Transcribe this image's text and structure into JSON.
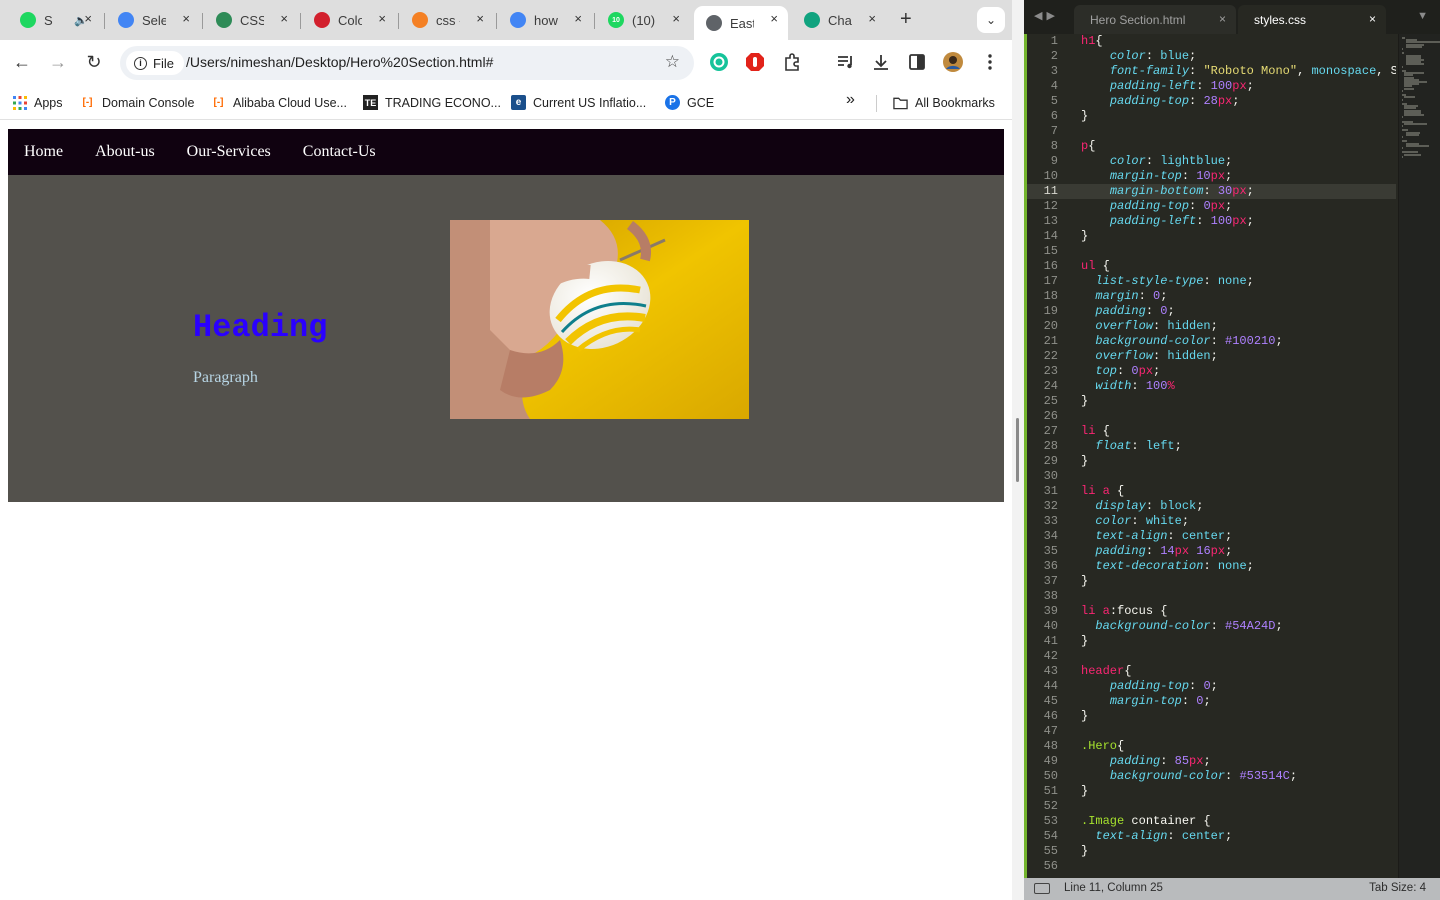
{
  "browser": {
    "tabs": [
      {
        "title": "S",
        "favicon_color": "#1ed760",
        "favicon": "spotify-icon"
      },
      {
        "title": "Selec",
        "favicon_color": "#4285f4",
        "favicon": "puzzle-icon"
      },
      {
        "title": "CSS",
        "favicon_color": "#2e8b57",
        "favicon": "w-icon"
      },
      {
        "title": "Colo",
        "favicon_color": "#d2202d",
        "favicon": "record-icon"
      },
      {
        "title": "css -",
        "favicon_color": "#f48024",
        "favicon": "stackoverflow-icon"
      },
      {
        "title": "how",
        "favicon_color": "#4285f4",
        "favicon": "google-icon"
      },
      {
        "title": "(10) ",
        "favicon_color": "#1ed760",
        "favicon": "badge-icon",
        "badge": "10"
      },
      {
        "title": "Easte",
        "favicon_color": "#5f6368",
        "favicon": "globe-icon"
      },
      {
        "title": "Chat",
        "favicon_color": "#10a37f",
        "favicon": "chatgpt-icon"
      }
    ],
    "tab_close": "×",
    "new_tab": "+",
    "tab_search": "⌄",
    "toolbar": {
      "back": "←",
      "forward": "→",
      "reload": "↻",
      "file_chip": "File",
      "url": "/Users/nimeshan/Desktop/Hero%20Section.html#",
      "star": "☆"
    },
    "bookmarks": [
      {
        "label": "Apps"
      },
      {
        "label": "Domain Console"
      },
      {
        "label": "Alibaba Cloud Use..."
      },
      {
        "label": "TRADING ECONO..."
      },
      {
        "label": "Current US Inflatio..."
      },
      {
        "label": "GCE"
      }
    ],
    "bookmarks_more": "»",
    "all_bookmarks": "All Bookmarks"
  },
  "page": {
    "nav": [
      "Home",
      "About-us",
      "Our-Services",
      "Contact-Us"
    ],
    "hero_heading": "Heading",
    "hero_paragraph": "Paragraph",
    "nav_bg": "#100210",
    "hero_bg": "#53514C"
  },
  "editor": {
    "tabs": [
      {
        "label": "Hero Section.html",
        "active": false
      },
      {
        "label": "styles.css",
        "active": true
      }
    ],
    "tab_close": "×",
    "current_line": 11,
    "lines": [
      "h1{",
      "    color: blue;",
      "    font-family: \"Roboto Mono\", monospace, Sa",
      "    padding-left: 100px;",
      "    padding-top: 28px;",
      "}",
      "",
      "p{",
      "    color: lightblue;",
      "    margin-top: 10px;",
      "    margin-bottom: 30px;",
      "    padding-top: 0px;",
      "    padding-left: 100px;",
      "}",
      "",
      "ul {",
      "  list-style-type: none;",
      "  margin: 0;",
      "  padding: 0;",
      "  overflow: hidden;",
      "  background-color: #100210;",
      "  overflow: hidden;",
      "  top: 0px;",
      "  width: 100%",
      "}",
      "",
      "li {",
      "  float: left;",
      "}",
      "",
      "li a {",
      "  display: block;",
      "  color: white;",
      "  text-align: center;",
      "  padding: 14px 16px;",
      "  text-decoration: none;",
      "}",
      "",
      "li a:focus {",
      "  background-color: #54A24D;",
      "}",
      "",
      "header{",
      "    padding-top: 0;",
      "    margin-top: 0;",
      "}",
      "",
      ".Hero{",
      "    padding: 85px;",
      "    background-color: #53514C;",
      "}",
      "",
      ".Image container {",
      "  text-align: center;",
      "}",
      ""
    ],
    "status": {
      "position": "Line 11, Column 25",
      "tab_size": "Tab Size: 4"
    },
    "gutter_color": "#74B52E"
  }
}
